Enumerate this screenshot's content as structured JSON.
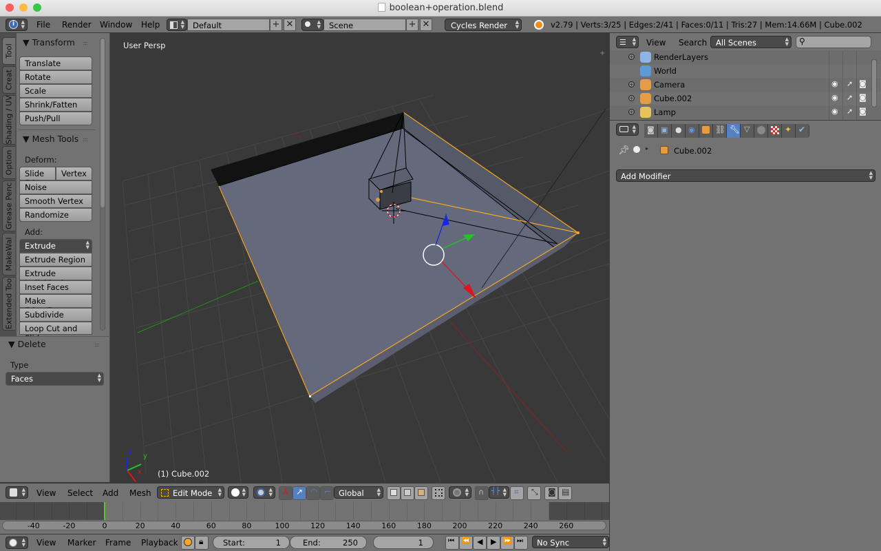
{
  "window": {
    "title": "boolean+operation.blend",
    "traffic_lights": {
      "close": "#fc605c",
      "minimize": "#fdbc40",
      "maximize": "#34c84a"
    }
  },
  "info_header": {
    "menus": [
      "File",
      "Render",
      "Window",
      "Help"
    ],
    "screen_layout": "Default",
    "scene": "Scene",
    "render_engine": "Cycles Render",
    "stats": "v2.79 | Verts:3/25 | Edges:2/41 | Faces:0/11 | Tris:27 | Mem:14.66M | Cube.002"
  },
  "toolshelf": {
    "tabs": [
      "Tool",
      "Creat",
      "Shading / UV",
      "Option",
      "Grease Penc",
      "MakeWal",
      "Extended Too"
    ],
    "active_tab": "Tool",
    "transform": {
      "title": "Transform",
      "buttons": [
        "Translate",
        "Rotate",
        "Scale",
        "Shrink/Fatten",
        "Push/Pull"
      ]
    },
    "mesh_tools": {
      "title": "Mesh Tools",
      "deform_label": "Deform:",
      "slide_edge": "Slide Ed",
      "vertex": "Vertex",
      "deform_buttons": [
        "Noise",
        "Smooth Vertex",
        "Randomize"
      ],
      "add_label": "Add:",
      "extrude": "Extrude",
      "add_buttons": [
        "Extrude Region",
        "Extrude Individual",
        "Inset Faces",
        "Make Edge/Face",
        "Subdivide",
        "Loop Cut and Slide"
      ]
    }
  },
  "last_operator": {
    "title": "Delete",
    "type_label": "Type",
    "type_value": "Faces"
  },
  "viewport": {
    "view_name": "User Persp",
    "object_label": "(1) Cube.002",
    "axis_labels": {
      "x": "x",
      "y": "y",
      "z": "z"
    },
    "colors": {
      "background": "#393939",
      "face": "#646a7c",
      "selected": "#f5a623",
      "x_axis": "#e0141e",
      "y_axis": "#1ea51e",
      "z_axis": "#1428e6"
    }
  },
  "view3d_header": {
    "menus": [
      "View",
      "Select",
      "Add",
      "Mesh"
    ],
    "mode": "Edit Mode",
    "orientation": "Global"
  },
  "timeline": {
    "ticks": [
      "-40",
      "-20",
      "0",
      "20",
      "40",
      "60",
      "80",
      "100",
      "120",
      "140",
      "160",
      "180",
      "200",
      "220",
      "240",
      "260"
    ],
    "current_frame_marker": 0,
    "menus": [
      "View",
      "Marker",
      "Frame",
      "Playback"
    ],
    "start_label": "Start:",
    "start_value": "1",
    "end_label": "End:",
    "end_value": "250",
    "current_frame": "1",
    "sync": "No Sync"
  },
  "outliner": {
    "menus": [
      "View",
      "Search"
    ],
    "display_mode": "All Scenes",
    "search_placeholder": "",
    "items": [
      {
        "name": "RenderLayers",
        "icon": "render-layers-icon",
        "expandable": true,
        "visibility": false
      },
      {
        "name": "World",
        "icon": "world-icon",
        "expandable": false,
        "visibility": false
      },
      {
        "name": "Camera",
        "icon": "camera-icon",
        "expandable": true,
        "visibility": true
      },
      {
        "name": "Cube.002",
        "icon": "mesh-icon",
        "expandable": true,
        "visibility": true
      },
      {
        "name": "Lamp",
        "icon": "lamp-icon",
        "expandable": true,
        "visibility": true
      }
    ]
  },
  "properties": {
    "tabs": [
      "render",
      "render-layers",
      "scene",
      "world",
      "object",
      "constraints",
      "modifiers",
      "data",
      "material",
      "texture",
      "particles",
      "physics"
    ],
    "active_tab": "modifiers",
    "breadcrumb_object": "Cube.002",
    "add_modifier": "Add Modifier"
  }
}
